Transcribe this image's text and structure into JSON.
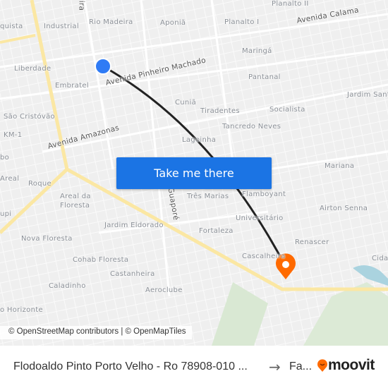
{
  "map": {
    "labels": [
      "Planalto II",
      "quista",
      "Industrial",
      "Rio Madeira",
      "Aponiã",
      "Planalto I",
      "Maringá",
      "Liberdade",
      "Pantanal",
      "Embratel",
      "Jardim Santana",
      "Cuniã",
      "Tiradentes",
      "Socialista",
      "São Cristóvão",
      "Tancredo Neves",
      "KM-1",
      "Lagoinha",
      "bo",
      "Mariana",
      "Areal",
      "Roque",
      "Três Marias",
      "Flamboyant",
      "Areal da",
      "Floresta",
      "Airton Senna",
      "Universitário",
      "Jardim Eldorado",
      "Fortaleza",
      "Nova Floresta",
      "Renascer",
      "Cascalheira",
      "Cida",
      "Cohab Floresta",
      "Castanheira",
      "Caladinho",
      "Aeroclube",
      "o Horizonte",
      "upi",
      "ira"
    ],
    "roads": [
      "Avenida Calama",
      "Avenida Pinheiro Machado",
      "Avenida Amazonas",
      "Guaporé"
    ],
    "origin_color": "#2f7bf5",
    "destination_color": "#ff6a00",
    "route_color": "#222222"
  },
  "button": {
    "label": "Take me there",
    "color": "#1b74e4"
  },
  "attribution": "© OpenStreetMap contributors | © OpenMapTiles",
  "footer": {
    "origin": "Flodoaldo Pinto Porto Velho - Ro 78908-010 ...",
    "destination": "Fa...",
    "brand": "moovit",
    "brand_color": "#ff6a00"
  }
}
